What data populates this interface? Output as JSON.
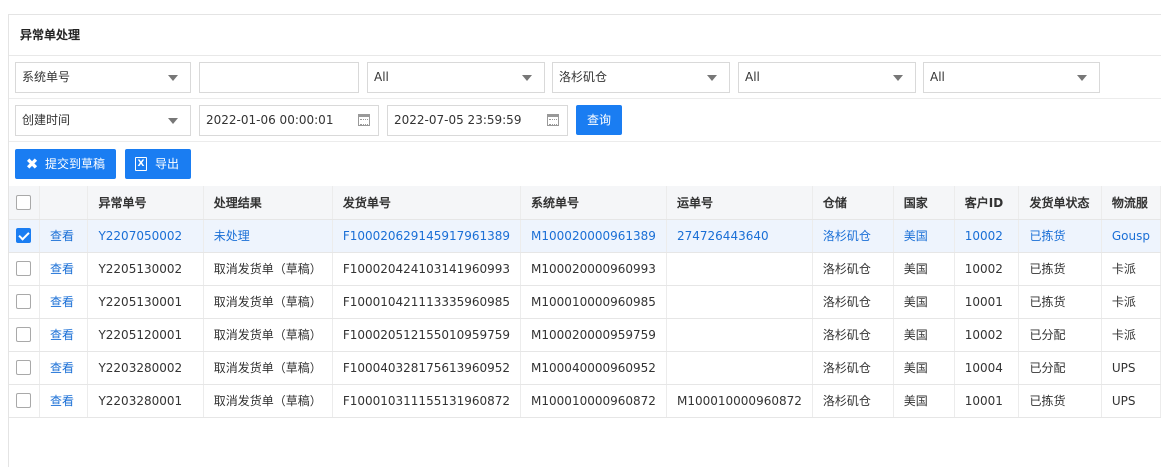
{
  "page": {
    "title": "异常单处理"
  },
  "filters": {
    "row1": {
      "field_select": "系统单号",
      "keyword_value": "",
      "select_a": "All",
      "warehouse_select": "洛杉矶仓",
      "select_c": "All",
      "select_d": "All"
    },
    "row2": {
      "time_type_select": "创建时间",
      "start_time": "2022-01-06 00:00:01",
      "end_time": "2022-07-05 23:59:59",
      "query_label": "查询"
    }
  },
  "actions": {
    "submit_draft_label": "提交到草稿",
    "export_label": "导出"
  },
  "colors": {
    "accent": "#1a7df2",
    "link": "#1a6fd6",
    "selected_row": "#eef4fd"
  },
  "table": {
    "headers": [
      "",
      "",
      "异常单号",
      "处理结果",
      "发货单号",
      "系统单号",
      "运单号",
      "仓储",
      "国家",
      "客户ID",
      "发货单状态",
      "物流服"
    ],
    "rows": [
      {
        "checked": true,
        "view": "查看",
        "exception_no": "Y2207050002",
        "result": "未处理",
        "ship_no": "F100020629145917961389",
        "system_no": "M100020000961389",
        "waybill": "274726443640",
        "warehouse": "洛杉矶仓",
        "country": "美国",
        "customer_id": "10002",
        "status": "已拣货",
        "logistics": "Gousp"
      },
      {
        "checked": false,
        "view": "查看",
        "exception_no": "Y2205130002",
        "result": "取消发货单（草稿）",
        "ship_no": "F100020424103141960993",
        "system_no": "M100020000960993",
        "waybill": "",
        "warehouse": "洛杉矶仓",
        "country": "美国",
        "customer_id": "10002",
        "status": "已拣货",
        "logistics": "卡派"
      },
      {
        "checked": false,
        "view": "查看",
        "exception_no": "Y2205130001",
        "result": "取消发货单（草稿）",
        "ship_no": "F100010421113335960985",
        "system_no": "M100010000960985",
        "waybill": "",
        "warehouse": "洛杉矶仓",
        "country": "美国",
        "customer_id": "10001",
        "status": "已拣货",
        "logistics": "卡派"
      },
      {
        "checked": false,
        "view": "查看",
        "exception_no": "Y2205120001",
        "result": "取消发货单（草稿）",
        "ship_no": "F100020512155010959759",
        "system_no": "M100020000959759",
        "waybill": "",
        "warehouse": "洛杉矶仓",
        "country": "美国",
        "customer_id": "10002",
        "status": "已分配",
        "logistics": "卡派"
      },
      {
        "checked": false,
        "view": "查看",
        "exception_no": "Y2203280002",
        "result": "取消发货单（草稿）",
        "ship_no": "F100040328175613960952",
        "system_no": "M100040000960952",
        "waybill": "",
        "warehouse": "洛杉矶仓",
        "country": "美国",
        "customer_id": "10004",
        "status": "已分配",
        "logistics": "UPS"
      },
      {
        "checked": false,
        "view": "查看",
        "exception_no": "Y2203280001",
        "result": "取消发货单（草稿）",
        "ship_no": "F100010311155131960872",
        "system_no": "M100010000960872",
        "waybill": "M100010000960872",
        "warehouse": "洛杉矶仓",
        "country": "美国",
        "customer_id": "10001",
        "status": "已拣货",
        "logistics": "UPS"
      }
    ]
  }
}
